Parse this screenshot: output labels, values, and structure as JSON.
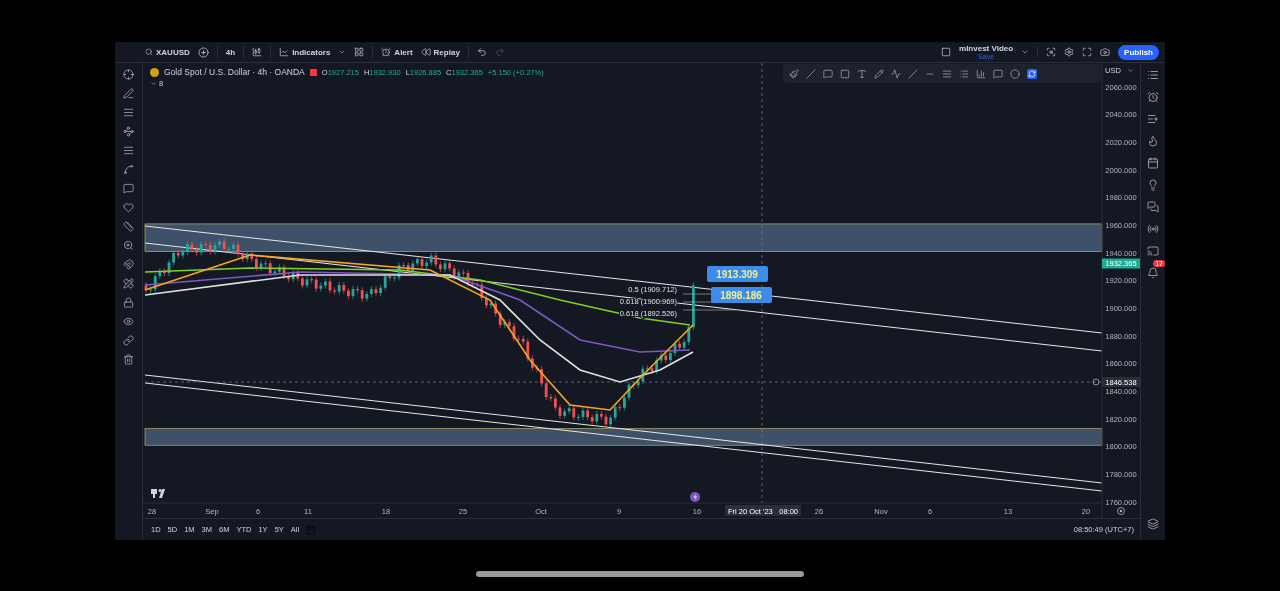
{
  "toolbar": {
    "symbol": "XAUUSD",
    "interval": "4h",
    "actions": [
      {
        "kind": "indicators",
        "label": "Indicators"
      },
      {
        "kind": "alert",
        "label": "Alert"
      },
      {
        "kind": "replay",
        "label": "Replay"
      }
    ],
    "layout_name": "mInvest Video",
    "layout_status": "Save",
    "publish": "Publish"
  },
  "legend": {
    "title": "Gold Spot / U.S. Dollar · 4h · OANDA",
    "ohlc": [
      {
        "label": "O",
        "value": "1927.215"
      },
      {
        "label": "H",
        "value": "1932.930"
      },
      {
        "label": "L",
        "value": "1926.885"
      },
      {
        "label": "C",
        "value": "1932.365"
      }
    ],
    "change": "+5.150 (+0.27%)",
    "indicator_count": "8"
  },
  "price_axis": {
    "currency": "USD",
    "labels": [
      "2060.000",
      "2040.000",
      "2020.000",
      "2000.000",
      "1980.000",
      "1960.000",
      "1940.000",
      "1920.000",
      "1900.000",
      "1880.000",
      "1860.000",
      "1840.000",
      "1820.000",
      "1800.000",
      "1780.000",
      "1760.000"
    ],
    "last_price": "1932.365",
    "crosshair_price": "1846.538"
  },
  "time_axis": {
    "labels": [
      "28",
      "Sep",
      "6",
      "11",
      "18",
      "25",
      "Oct",
      "9",
      "16",
      "26",
      "Nov",
      "6",
      "13",
      "20"
    ],
    "crosshair_date": "Fri 20 Oct '23",
    "crosshair_time": "08:00"
  },
  "fib_levels": [
    "0.5 (1909.712)",
    "0.618 (1900.969)",
    "0.618 (1892.526)"
  ],
  "price_callouts": [
    "1913.309",
    "1898.186"
  ],
  "ranges": [
    "1D",
    "5D",
    "1M",
    "3M",
    "6M",
    "YTD",
    "1Y",
    "5Y",
    "All"
  ],
  "clock": "08:50:49 (UTC+7)",
  "notification_badge": "17"
}
